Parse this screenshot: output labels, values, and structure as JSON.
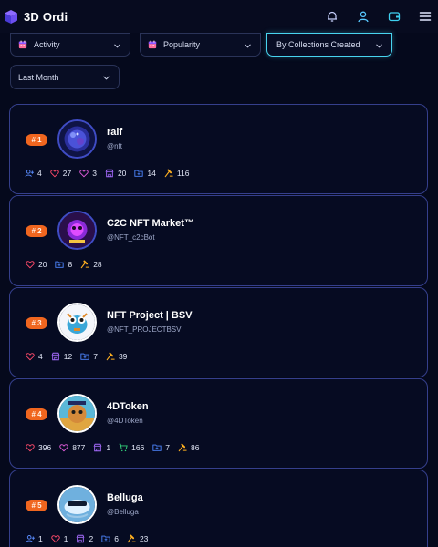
{
  "app": {
    "name": "3D Ordi"
  },
  "filters": {
    "activity": "Activity",
    "popularity": "Popularity",
    "collections": "By Collections Created",
    "period": "Last Month"
  },
  "colors": {
    "accent_cyan": "#48d4ef",
    "rank_orange": "#f0661f",
    "card_border": "#353f8c",
    "background": "#05091c"
  },
  "stat_icon_names": {
    "followers": "user-plus-icon",
    "likes": "heart-icon",
    "favorites": "heart-outline-icon",
    "stores": "store-icon",
    "collections": "folder-icon",
    "carts": "cart-icon",
    "auctions": "gavel-icon"
  },
  "creators": [
    {
      "rank": "# 1",
      "name": "ralf",
      "handle": "@nft",
      "stats": {
        "followers": "4",
        "likes": "27",
        "favorites": "3",
        "stores": "20",
        "collections": "14",
        "auctions": "116"
      }
    },
    {
      "rank": "# 2",
      "name": "C2C NFT Market™",
      "handle": "@NFT_c2cBot",
      "stats": {
        "likes": "20",
        "collections": "8",
        "auctions": "28"
      }
    },
    {
      "rank": "# 3",
      "name": "NFT Project | BSV",
      "handle": "@NFT_PROJECTBSV",
      "stats": {
        "likes": "4",
        "stores": "12",
        "collections": "7",
        "auctions": "39"
      }
    },
    {
      "rank": "# 4",
      "name": "4DToken",
      "handle": "@4DToken",
      "stats": {
        "likes": "396",
        "favorites": "877",
        "stores": "1",
        "carts": "166",
        "collections": "7",
        "auctions": "86"
      }
    },
    {
      "rank": "# 5",
      "name": "Belluga",
      "handle": "@Belluga",
      "stats": {
        "followers": "1",
        "likes": "1",
        "stores": "2",
        "collections": "6",
        "auctions": "23"
      }
    }
  ]
}
